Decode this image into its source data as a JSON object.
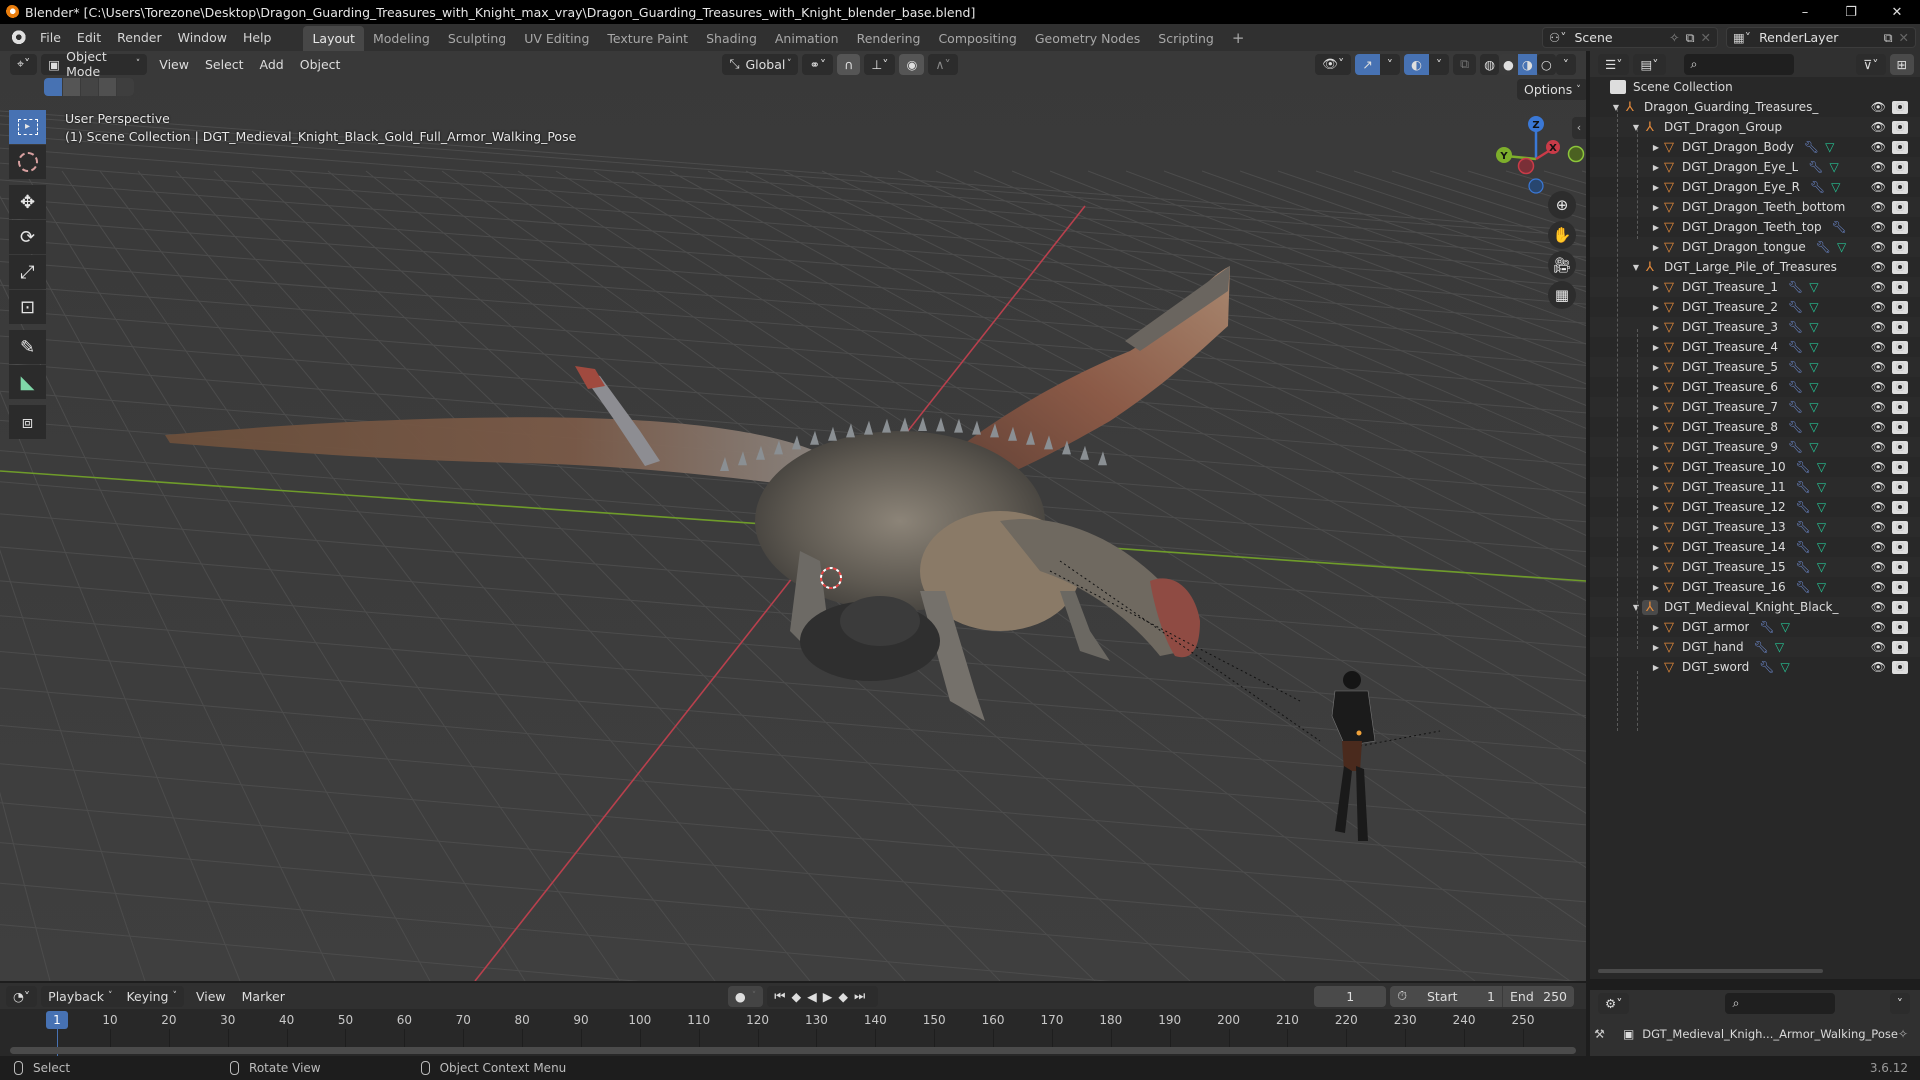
{
  "window": {
    "title": "Blender* [C:\\Users\\Torezone\\Desktop\\Dragon_Guarding_Treasures_with_Knight_max_vray\\Dragon_Guarding_Treasures_with_Knight_blender_base.blend]",
    "minimize": "–",
    "maximize": "❐",
    "close": "✕"
  },
  "menu": [
    "File",
    "Edit",
    "Render",
    "Window",
    "Help"
  ],
  "workspaces": [
    "Layout",
    "Modeling",
    "Sculpting",
    "UV Editing",
    "Texture Paint",
    "Shading",
    "Animation",
    "Rendering",
    "Compositing",
    "Geometry Nodes",
    "Scripting",
    "+"
  ],
  "active_workspace": "Layout",
  "scene": {
    "name": "Scene",
    "view_layer": "RenderLayer"
  },
  "viewport": {
    "mode": "Object Mode",
    "menus": [
      "View",
      "Select",
      "Add",
      "Object"
    ],
    "transform_orientation": "Global",
    "options_label": "Options",
    "overlay_line1": "User Perspective",
    "overlay_line2": "(1) Scene Collection | DGT_Medieval_Knight_Black_Gold_Full_Armor_Walking_Pose",
    "gizmo": {
      "x": "X",
      "y": "Y",
      "z": "Z"
    },
    "colors": {
      "x_axis": "#c93b48",
      "y_axis": "#7dae2b",
      "z_axis": "#3a78d6",
      "grid_bg": "#3d3d3d",
      "active_tool": "#4772b3"
    }
  },
  "tools": [
    "select-box",
    "cursor",
    "move",
    "rotate",
    "scale",
    "transform",
    "annotate",
    "measure",
    "add-cube"
  ],
  "outliner": {
    "root": "Scene Collection",
    "rows": [
      {
        "name": "Dragon_Guarding_Treasures_with_Knigh",
        "type": "collection",
        "depth": 0,
        "expanded": true
      },
      {
        "name": "DGT_Dragon_Group",
        "type": "collection",
        "depth": 1,
        "expanded": true
      },
      {
        "name": "DGT_Dragon_Body",
        "type": "mesh",
        "depth": 2,
        "mod": true,
        "data": true
      },
      {
        "name": "DGT_Dragon_Eye_L",
        "type": "mesh",
        "depth": 2,
        "mod": true,
        "data": true
      },
      {
        "name": "DGT_Dragon_Eye_R",
        "type": "mesh",
        "depth": 2,
        "mod": true,
        "data": true
      },
      {
        "name": "DGT_Dragon_Teeth_bottom",
        "type": "mesh",
        "depth": 2,
        "mod": false,
        "data": false
      },
      {
        "name": "DGT_Dragon_Teeth_top",
        "type": "mesh",
        "depth": 2,
        "mod": true,
        "data": false
      },
      {
        "name": "DGT_Dragon_tongue",
        "type": "mesh",
        "depth": 2,
        "mod": true,
        "data": true
      },
      {
        "name": "DGT_Large_Pile_of_Treasures",
        "type": "collection",
        "depth": 1,
        "expanded": true
      },
      {
        "name": "DGT_Treasure_1",
        "type": "mesh",
        "depth": 2,
        "mod": true,
        "data": true
      },
      {
        "name": "DGT_Treasure_2",
        "type": "mesh",
        "depth": 2,
        "mod": true,
        "data": true
      },
      {
        "name": "DGT_Treasure_3",
        "type": "mesh",
        "depth": 2,
        "mod": true,
        "data": true
      },
      {
        "name": "DGT_Treasure_4",
        "type": "mesh",
        "depth": 2,
        "mod": true,
        "data": true
      },
      {
        "name": "DGT_Treasure_5",
        "type": "mesh",
        "depth": 2,
        "mod": true,
        "data": true
      },
      {
        "name": "DGT_Treasure_6",
        "type": "mesh",
        "depth": 2,
        "mod": true,
        "data": true
      },
      {
        "name": "DGT_Treasure_7",
        "type": "mesh",
        "depth": 2,
        "mod": true,
        "data": true
      },
      {
        "name": "DGT_Treasure_8",
        "type": "mesh",
        "depth": 2,
        "mod": true,
        "data": true
      },
      {
        "name": "DGT_Treasure_9",
        "type": "mesh",
        "depth": 2,
        "mod": true,
        "data": true
      },
      {
        "name": "DGT_Treasure_10",
        "type": "mesh",
        "depth": 2,
        "mod": true,
        "data": true
      },
      {
        "name": "DGT_Treasure_11",
        "type": "mesh",
        "depth": 2,
        "mod": true,
        "data": true
      },
      {
        "name": "DGT_Treasure_12",
        "type": "mesh",
        "depth": 2,
        "mod": true,
        "data": true
      },
      {
        "name": "DGT_Treasure_13",
        "type": "mesh",
        "depth": 2,
        "mod": true,
        "data": true
      },
      {
        "name": "DGT_Treasure_14",
        "type": "mesh",
        "depth": 2,
        "mod": true,
        "data": true
      },
      {
        "name": "DGT_Treasure_15",
        "type": "mesh",
        "depth": 2,
        "mod": true,
        "data": true
      },
      {
        "name": "DGT_Treasure_16",
        "type": "mesh",
        "depth": 2,
        "mod": true,
        "data": true
      },
      {
        "name": "DGT_Medieval_Knight_Black_Gold_l",
        "type": "collection",
        "depth": 1,
        "expanded": true,
        "active": true
      },
      {
        "name": "DGT_armor",
        "type": "mesh",
        "depth": 2,
        "mod": true,
        "data": true
      },
      {
        "name": "DGT_hand",
        "type": "mesh",
        "depth": 2,
        "mod": true,
        "data": true
      },
      {
        "name": "DGT_sword",
        "type": "mesh",
        "depth": 2,
        "mod": true,
        "data": true
      }
    ]
  },
  "properties": {
    "context_object": "DGT_Medieval_Knigh..._Armor_Walking_Pose"
  },
  "timeline": {
    "menus": [
      "Playback",
      "Keying",
      "View",
      "Marker"
    ],
    "current_frame": "1",
    "start_label": "Start",
    "start": "1",
    "end_label": "End",
    "end": "250",
    "ticks": [
      "10",
      "20",
      "30",
      "40",
      "50",
      "60",
      "70",
      "80",
      "90",
      "100",
      "110",
      "120",
      "130",
      "140",
      "150",
      "160",
      "170",
      "180",
      "190",
      "200",
      "210",
      "220",
      "230",
      "240",
      "250"
    ],
    "playhead_label": "1"
  },
  "statusbar": {
    "select": "Select",
    "rotate": "Rotate View",
    "context_menu": "Object Context Menu",
    "version": "3.6.12"
  }
}
